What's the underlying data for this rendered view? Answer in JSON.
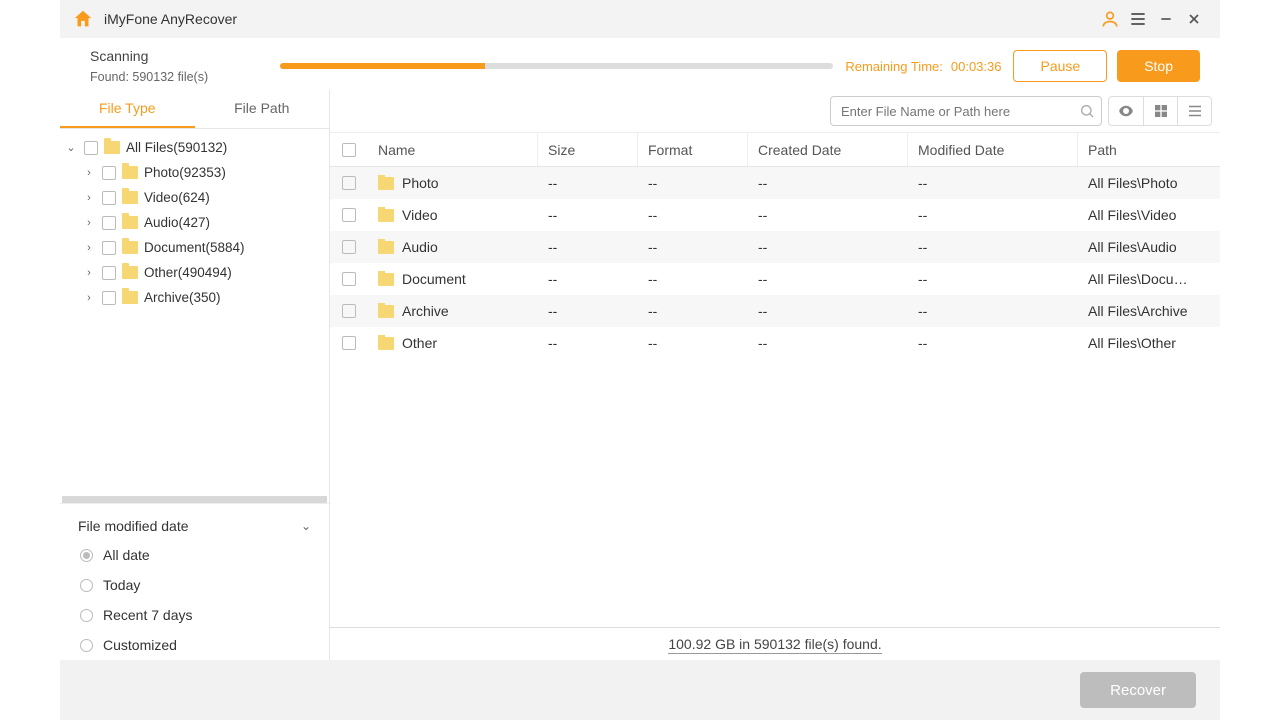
{
  "app": {
    "title": "iMyFone AnyRecover"
  },
  "scan": {
    "status_label": "Scanning",
    "found_label": "Found: 590132 file(s)",
    "progress_pct": 37,
    "remaining_label": "Remaining Time:",
    "remaining_time": "00:03:36",
    "pause_label": "Pause",
    "stop_label": "Stop"
  },
  "sidebar": {
    "tabs": {
      "file_type": "File Type",
      "file_path": "File Path"
    },
    "tree": {
      "root": "All Files(590132)",
      "children": [
        "Photo(92353)",
        "Video(624)",
        "Audio(427)",
        "Document(5884)",
        "Other(490494)",
        "Archive(350)"
      ]
    },
    "filter": {
      "header": "File modified date",
      "options": [
        "All date",
        "Today",
        "Recent 7 days",
        "Customized"
      ],
      "selected": 0
    }
  },
  "toolbar": {
    "search_placeholder": "Enter File Name or Path here"
  },
  "columns": [
    "Name",
    "Size",
    "Format",
    "Created Date",
    "Modified Date",
    "Path"
  ],
  "rows": [
    {
      "name": "Photo",
      "size": "--",
      "format": "--",
      "created": "--",
      "modified": "--",
      "path": "All Files\\Photo"
    },
    {
      "name": "Video",
      "size": "--",
      "format": "--",
      "created": "--",
      "modified": "--",
      "path": "All Files\\Video"
    },
    {
      "name": "Audio",
      "size": "--",
      "format": "--",
      "created": "--",
      "modified": "--",
      "path": "All Files\\Audio"
    },
    {
      "name": "Document",
      "size": "--",
      "format": "--",
      "created": "--",
      "modified": "--",
      "path": "All Files\\Docu…"
    },
    {
      "name": "Archive",
      "size": "--",
      "format": "--",
      "created": "--",
      "modified": "--",
      "path": "All Files\\Archive"
    },
    {
      "name": "Other",
      "size": "--",
      "format": "--",
      "created": "--",
      "modified": "--",
      "path": "All Files\\Other"
    }
  ],
  "summary": "100.92 GB in 590132 file(s) found.",
  "footer": {
    "recover_label": "Recover"
  }
}
